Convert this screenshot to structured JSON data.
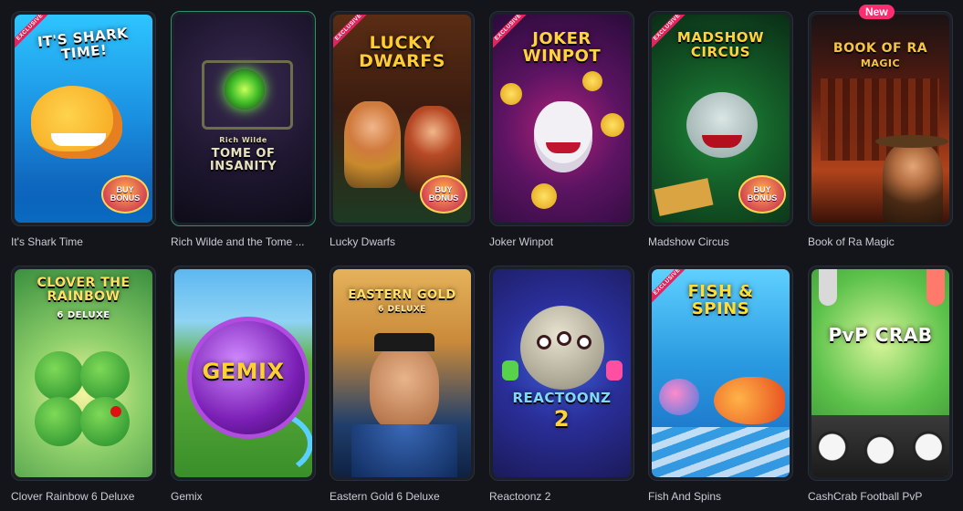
{
  "games": [
    {
      "title": "It's Shark Time",
      "logo": "IT'S SHARK TIME!",
      "exclusive": "EXCLUSIVE",
      "buy_bonus": "BUY BONUS"
    },
    {
      "title": "Rich Wilde and the Tome ...",
      "logo": "TOME OF INSANITY",
      "logo_small": "Rich Wilde"
    },
    {
      "title": "Lucky Dwarfs",
      "logo": "LUCKY DWARFS",
      "exclusive": "EXCLUSIVE",
      "buy_bonus": "BUY BONUS"
    },
    {
      "title": "Joker Winpot",
      "logo": "JOKER WINPOT",
      "exclusive": "EXCLUSIVE"
    },
    {
      "title": "Madshow Circus",
      "logo": "MADSHOW CIRCUS",
      "exclusive": "EXCLUSIVE",
      "buy_bonus": "BUY BONUS"
    },
    {
      "title": "Book of Ra Magic",
      "logo": "BOOK OF RA",
      "logo_small": "MAGIC",
      "badge": "New"
    },
    {
      "title": "Clover Rainbow 6 Deluxe",
      "logo": "CLOVER THE RAINBOW",
      "logo_small": "6 DELUXE"
    },
    {
      "title": "Gemix",
      "logo": "GEMIX"
    },
    {
      "title": "Eastern Gold 6 Deluxe",
      "logo": "EASTERN GOLD",
      "logo_small": "6 DELUXE"
    },
    {
      "title": "Reactoonz 2",
      "logo": "REACTOONZ",
      "logo_small": "2"
    },
    {
      "title": "Fish And Spins",
      "logo": "FISH & SPINS",
      "exclusive": "EXCLUSIVE"
    },
    {
      "title": "CashCrab Football PvP",
      "logo": "PvP CRAB"
    }
  ]
}
